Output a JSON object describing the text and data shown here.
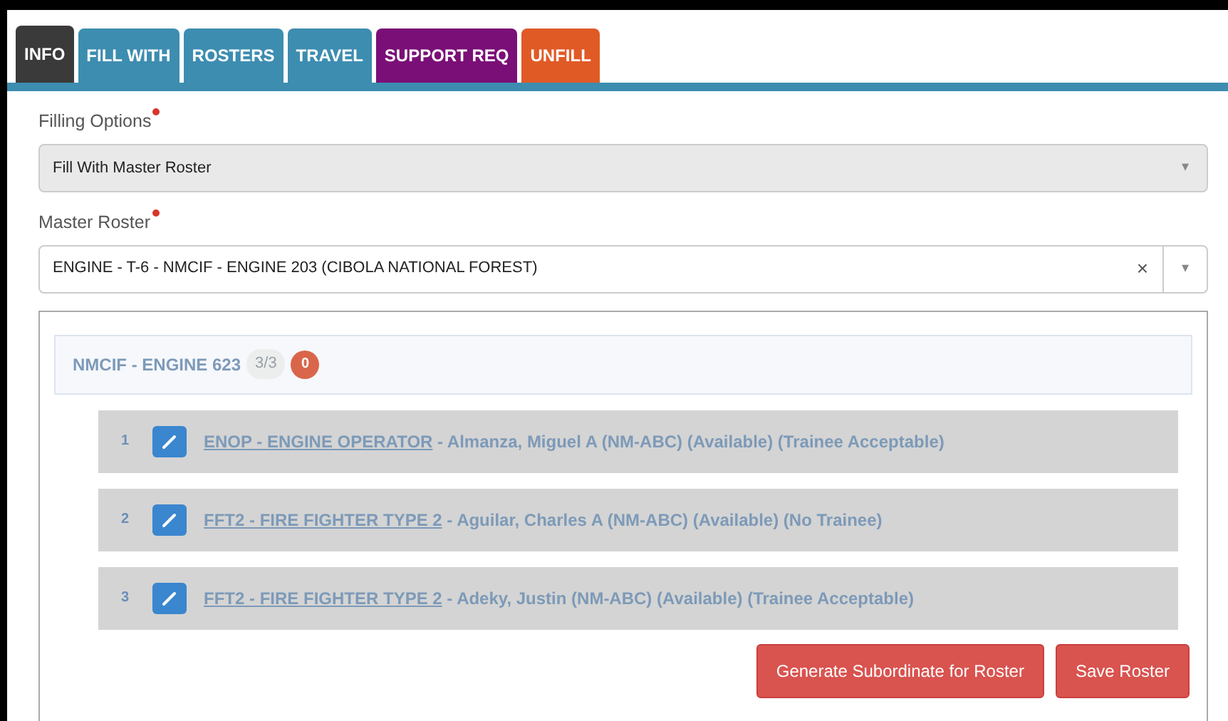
{
  "tabs": [
    {
      "label": "INFO",
      "selected": true,
      "color": "#3a3a3a"
    },
    {
      "label": "FILL WITH",
      "selected": false,
      "color": "#3d8db0"
    },
    {
      "label": "ROSTERS",
      "selected": false,
      "color": "#3d8db0"
    },
    {
      "label": "TRAVEL",
      "selected": false,
      "color": "#3d8db0"
    },
    {
      "label": "SUPPORT REQ",
      "selected": false,
      "color": "#7a0f77"
    },
    {
      "label": "UNFILL",
      "selected": false,
      "color": "#e05a26"
    }
  ],
  "filling_options": {
    "label": "Filling Options",
    "required": true,
    "value": "Fill With Master Roster",
    "disabled": true,
    "caret": "▾"
  },
  "master_roster": {
    "label": "Master Roster",
    "required": true,
    "value": "ENGINE - T-6 - NMCIF - ENGINE 203 (CIBOLA NATIONAL FOREST)",
    "clear": "×",
    "caret": "▾"
  },
  "group": {
    "title": "NMCIF - ENGINE 623",
    "count": "3/3",
    "badge": "0"
  },
  "members": [
    {
      "number": "1",
      "position": "ENOP - ENGINE OPERATOR",
      "details": " - Almanza, Miguel A (NM-ABC) (Available) (Trainee Acceptable)"
    },
    {
      "number": "2",
      "position": "FFT2 - FIRE FIGHTER TYPE 2",
      "details": " - Aguilar, Charles A (NM-ABC) (Available) (No Trainee)"
    },
    {
      "number": "3",
      "position": "FFT2 - FIRE FIGHTER TYPE 2",
      "details": " - Adeky, Justin (NM-ABC) (Available) (Trainee Acceptable)"
    }
  ],
  "buttons": [
    "Generate Subordinate for Roster",
    "Save Roster"
  ]
}
